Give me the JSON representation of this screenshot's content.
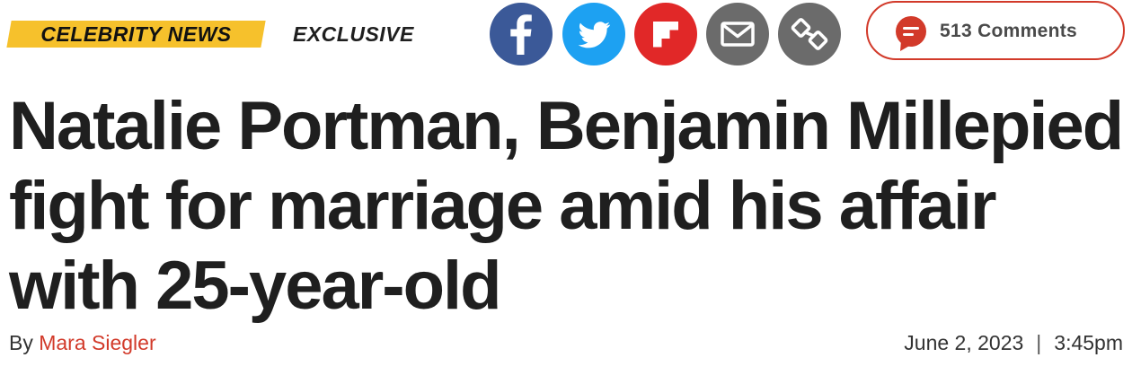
{
  "tags": {
    "category": "CELEBRITY NEWS",
    "exclusive": "EXCLUSIVE"
  },
  "share": {
    "icons": [
      "facebook-icon",
      "twitter-icon",
      "flipboard-icon",
      "email-icon",
      "link-icon"
    ],
    "colors": {
      "facebook": "#3b5998",
      "twitter": "#1da1f2",
      "flipboard": "#e12828",
      "email": "#6b6b6b",
      "link": "#6b6b6b"
    }
  },
  "comments": {
    "label": "513 Comments",
    "accent": "#d23a2a"
  },
  "article": {
    "headline": "Natalie Portman, Benjamin Millepied fight for marriage amid his affair with 25-year-old",
    "byline_prefix": "By",
    "author": "Mara Siegler",
    "date": "June 2, 2023",
    "separator": "|",
    "time": "3:45pm"
  }
}
